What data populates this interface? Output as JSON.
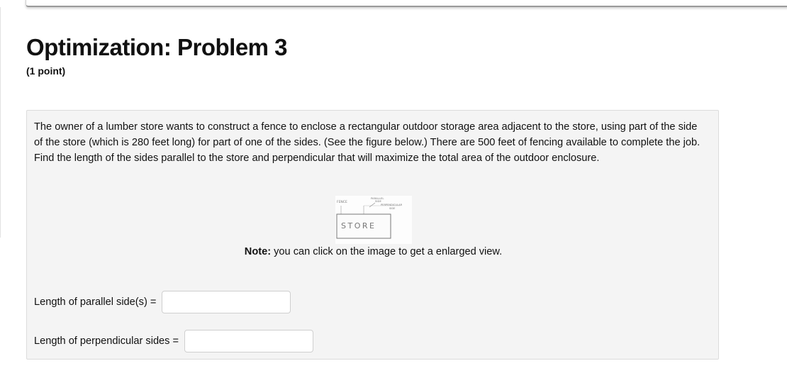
{
  "problem": {
    "title": "Optimization: Problem 3",
    "points": "(1 point)",
    "statement": "The owner of a lumber store wants to construct a fence to enclose a rectangular outdoor storage area adjacent to the store, using part of the side of the store (which is 280 feet long) for part of one of the sides. (See the figure below.) There are 500 feet of fencing available to complete the job. Find the length of the sides parallel to the store and perpendicular that will maximize the total area of the outdoor enclosure.",
    "note_label": "Note:",
    "note_text": " you can click on the image to get a enlarged view."
  },
  "figure": {
    "fence_label": "FENCE",
    "parallel_label_1": "PARALLEL",
    "parallel_label_2": "SIDE",
    "perpendicular_label_1": "PERPENDICULAR",
    "perpendicular_label_2": "SIDE",
    "store_label": "STORE"
  },
  "answers": [
    {
      "label": "Length of parallel side(s) =",
      "value": "",
      "placeholder": ""
    },
    {
      "label": "Length of perpendicular sides =",
      "value": "",
      "placeholder": ""
    }
  ]
}
